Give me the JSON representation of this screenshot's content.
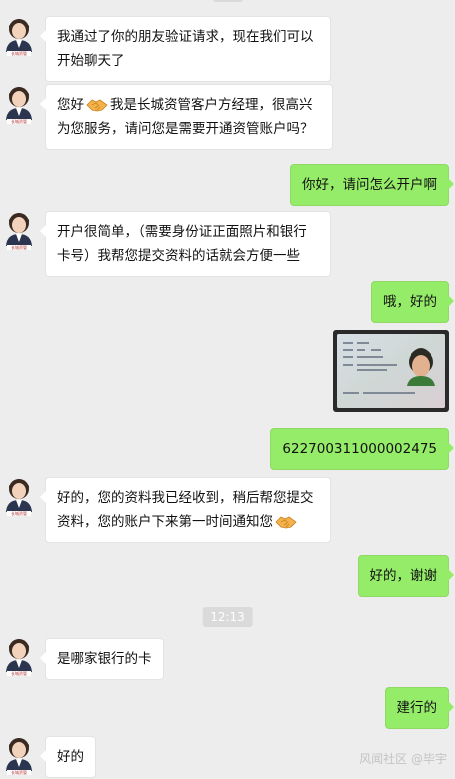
{
  "messages": [
    {
      "side": "left",
      "lines": [
        "我通过了你的朋友验证请求，现在我们可以",
        "开始聊天了"
      ]
    },
    {
      "side": "left",
      "lines": [
        "您好",
        "我是长城资管客户方经理，很高兴",
        "为您服务，请问您是需要开通资管账户吗？"
      ],
      "emoji": "handshake-emoji"
    },
    {
      "side": "right",
      "text": "你好，请问怎么开户啊"
    },
    {
      "side": "left",
      "lines": [
        "开户很简单，（需要身份证正面照片和银行",
        "卡号）我帮您提交资料的话就会方便一些"
      ]
    },
    {
      "side": "right",
      "text": "哦，好的"
    },
    {
      "side": "right",
      "type": "image",
      "image": "id-card-photo"
    },
    {
      "side": "right",
      "text": "622700311000002475"
    },
    {
      "side": "left",
      "lines": [
        "好的，您的资料我已经收到，稍后帮您提交",
        "资料，您的账户下来第一时间通知您"
      ],
      "emoji": "handshake-emoji"
    },
    {
      "side": "right",
      "text": "好的，谢谢"
    },
    {
      "side": "left",
      "text": "是哪家银行的卡"
    },
    {
      "side": "right",
      "text": "建行的"
    },
    {
      "side": "left",
      "text": "好的"
    }
  ],
  "timestamps": [
    "12:13"
  ],
  "watermark": "风闻社区 @毕宇",
  "colors": {
    "background": "#ededed",
    "bubble_left": "#ffffff",
    "bubble_right": "#95ec69",
    "timestamp_pill": "#dadada"
  }
}
